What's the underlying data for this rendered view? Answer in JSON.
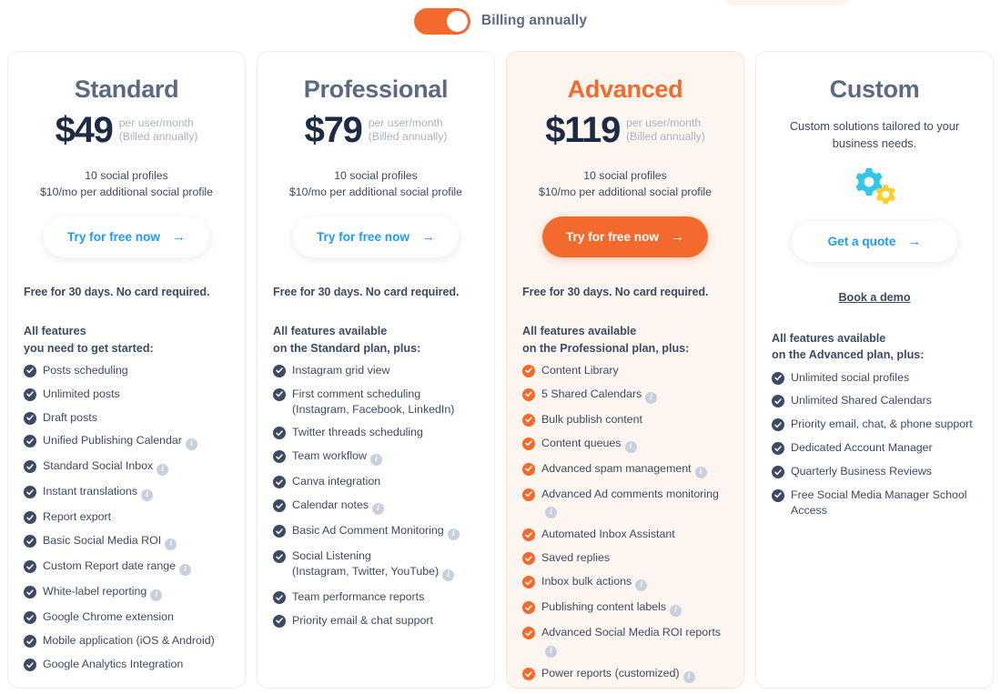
{
  "billing": {
    "toggle_state": "on",
    "label": "Billing annually",
    "accent_color": "#f4692c"
  },
  "colors": {
    "accent_orange": "#f4692c",
    "link_blue": "#1f9bf5",
    "title_slate": "#5d6881",
    "price_navy": "#1d2b45",
    "muted": "#a9b1c1",
    "highlight_bg": "#fdf6f0",
    "gear_cyan": "#33c6e8",
    "gear_yellow": "#fbd02e"
  },
  "plans": [
    {
      "name": "Standard",
      "price": "$49",
      "price_note_line1": "per user/month",
      "price_note_line2": "(Billed annually)",
      "profiles_line1": "10 social profiles",
      "profiles_line2": "$10/mo per additional social profile",
      "cta_label": "Try for free now",
      "cta_arrow": "→",
      "trial_note": "Free for 30 days. No card required.",
      "features_head_line1": "All features",
      "features_head_line2": "you need to get started:",
      "features": [
        {
          "label": "Posts scheduling",
          "info": false
        },
        {
          "label": "Unlimited posts",
          "info": false
        },
        {
          "label": "Draft posts",
          "info": false
        },
        {
          "label": "Unified Publishing Calendar",
          "info": true
        },
        {
          "label": "Standard Social Inbox",
          "info": true
        },
        {
          "label": "Instant translations",
          "info": true
        },
        {
          "label": "Report export",
          "info": false
        },
        {
          "label": "Basic Social Media ROI",
          "info": true
        },
        {
          "label": "Custom Report date range",
          "info": true
        },
        {
          "label": "White-label reporting",
          "info": true
        },
        {
          "label": "Google Chrome extension",
          "info": false
        },
        {
          "label": "Mobile application (iOS & Android)",
          "info": false
        },
        {
          "label": "Google Analytics Integration",
          "info": false
        }
      ]
    },
    {
      "name": "Professional",
      "price": "$79",
      "price_note_line1": "per user/month",
      "price_note_line2": "(Billed annually)",
      "profiles_line1": "10 social profiles",
      "profiles_line2": "$10/mo per additional social profile",
      "cta_label": "Try for free now",
      "cta_arrow": "→",
      "trial_note": "Free for 30 days. No card required.",
      "features_head_line1": "All features available",
      "features_head_line2": "on the Standard plan, plus:",
      "features": [
        {
          "label": "Instagram grid view",
          "info": false
        },
        {
          "label": "First comment scheduling",
          "sub": "(Instagram, Facebook, LinkedIn)",
          "info": false
        },
        {
          "label": "Twitter threads scheduling",
          "info": false
        },
        {
          "label": "Team workflow",
          "info": true
        },
        {
          "label": "Canva integration",
          "info": false
        },
        {
          "label": "Calendar notes",
          "info": true
        },
        {
          "label": "Basic Ad Comment Monitoring",
          "info": true
        },
        {
          "label": "Social Listening",
          "sub": "(Instagram, Twitter, YouTube)",
          "info": true,
          "info_on_sub": true
        },
        {
          "label": "Team performance reports",
          "info": false
        },
        {
          "label": "Priority email & chat support",
          "info": false
        }
      ]
    },
    {
      "name": "Advanced",
      "highlighted": true,
      "price": "$119",
      "price_note_line1": "per user/month",
      "price_note_line2": "(Billed annually)",
      "profiles_line1": "10 social profiles",
      "profiles_line2": "$10/mo per additional social profile",
      "cta_label": "Try for free now",
      "cta_arrow": "→",
      "trial_note": "Free for 30 days. No card required.",
      "features_head_line1": "All features available",
      "features_head_line2": "on the Professional plan, plus:",
      "features": [
        {
          "label": "Content Library",
          "info": false
        },
        {
          "label": "5 Shared Calendars",
          "info": true
        },
        {
          "label": "Bulk publish content",
          "info": false
        },
        {
          "label": "Content queues",
          "info": true
        },
        {
          "label": "Advanced spam management",
          "info": true
        },
        {
          "label": "Advanced Ad comments monitoring",
          "info": true
        },
        {
          "label": "Automated Inbox Assistant",
          "info": false
        },
        {
          "label": "Saved replies",
          "info": false
        },
        {
          "label": "Inbox bulk actions",
          "info": true
        },
        {
          "label": "Publishing content labels",
          "info": true
        },
        {
          "label": "Advanced Social Media ROI reports",
          "info": true
        },
        {
          "label": "Power reports (customized)",
          "info": true
        }
      ]
    },
    {
      "name": "Custom",
      "description": "Custom solutions tailored to your business needs.",
      "icon": "gears-icon",
      "cta_label": "Get a quote",
      "cta_arrow": "→",
      "demo_link": "Book a demo",
      "features_head_line1": "All features available",
      "features_head_line2": "on the Advanced plan, plus:",
      "features": [
        {
          "label": "Unlimited social profiles",
          "info": false
        },
        {
          "label": "Unlimited Shared Calendars",
          "info": false
        },
        {
          "label": "Priority email, chat, & phone support",
          "info": false
        },
        {
          "label": "Dedicated Account Manager",
          "info": false
        },
        {
          "label": "Quarterly Business Reviews",
          "info": false
        },
        {
          "label": "Free Social Media Manager School",
          "sub": "Access",
          "info": false
        }
      ]
    }
  ]
}
